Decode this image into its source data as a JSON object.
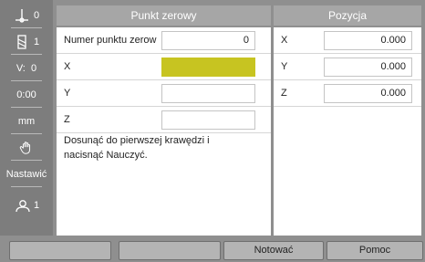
{
  "sidebar": {
    "items": [
      {
        "icon": "axis-icon",
        "value": "0"
      },
      {
        "icon": "tool-icon",
        "value": "1"
      },
      {
        "label": "V:",
        "value": "0"
      },
      {
        "value": "0:00"
      },
      {
        "value": "mm"
      },
      {
        "icon": "hand-icon",
        "value": ""
      },
      {
        "value": "Nastawić"
      },
      {
        "icon": "user-icon",
        "value": "1"
      }
    ]
  },
  "left_panel": {
    "title": "Punkt zerowy",
    "rows": [
      {
        "label": "Numer punktu zerow",
        "value": "0"
      },
      {
        "label": "X",
        "value": ""
      },
      {
        "label": "Y",
        "value": ""
      },
      {
        "label": "Z",
        "value": ""
      }
    ],
    "message": "Dosunąć do pierwszej krawędzi i nacisnąć Nauczyć."
  },
  "right_panel": {
    "title": "Pozycja",
    "rows": [
      {
        "label": "X",
        "value": "0.000"
      },
      {
        "label": "Y",
        "value": "0.000"
      },
      {
        "label": "Z",
        "value": "0.000"
      }
    ]
  },
  "softkeys": [
    {
      "label": ""
    },
    {
      "label": ""
    },
    {
      "label": "Notować"
    },
    {
      "label": "Pomoc"
    }
  ],
  "colors": {
    "active_field": "#c7c421",
    "panel_header": "#a6a6a6",
    "sidebar": "#7d7d7d"
  }
}
